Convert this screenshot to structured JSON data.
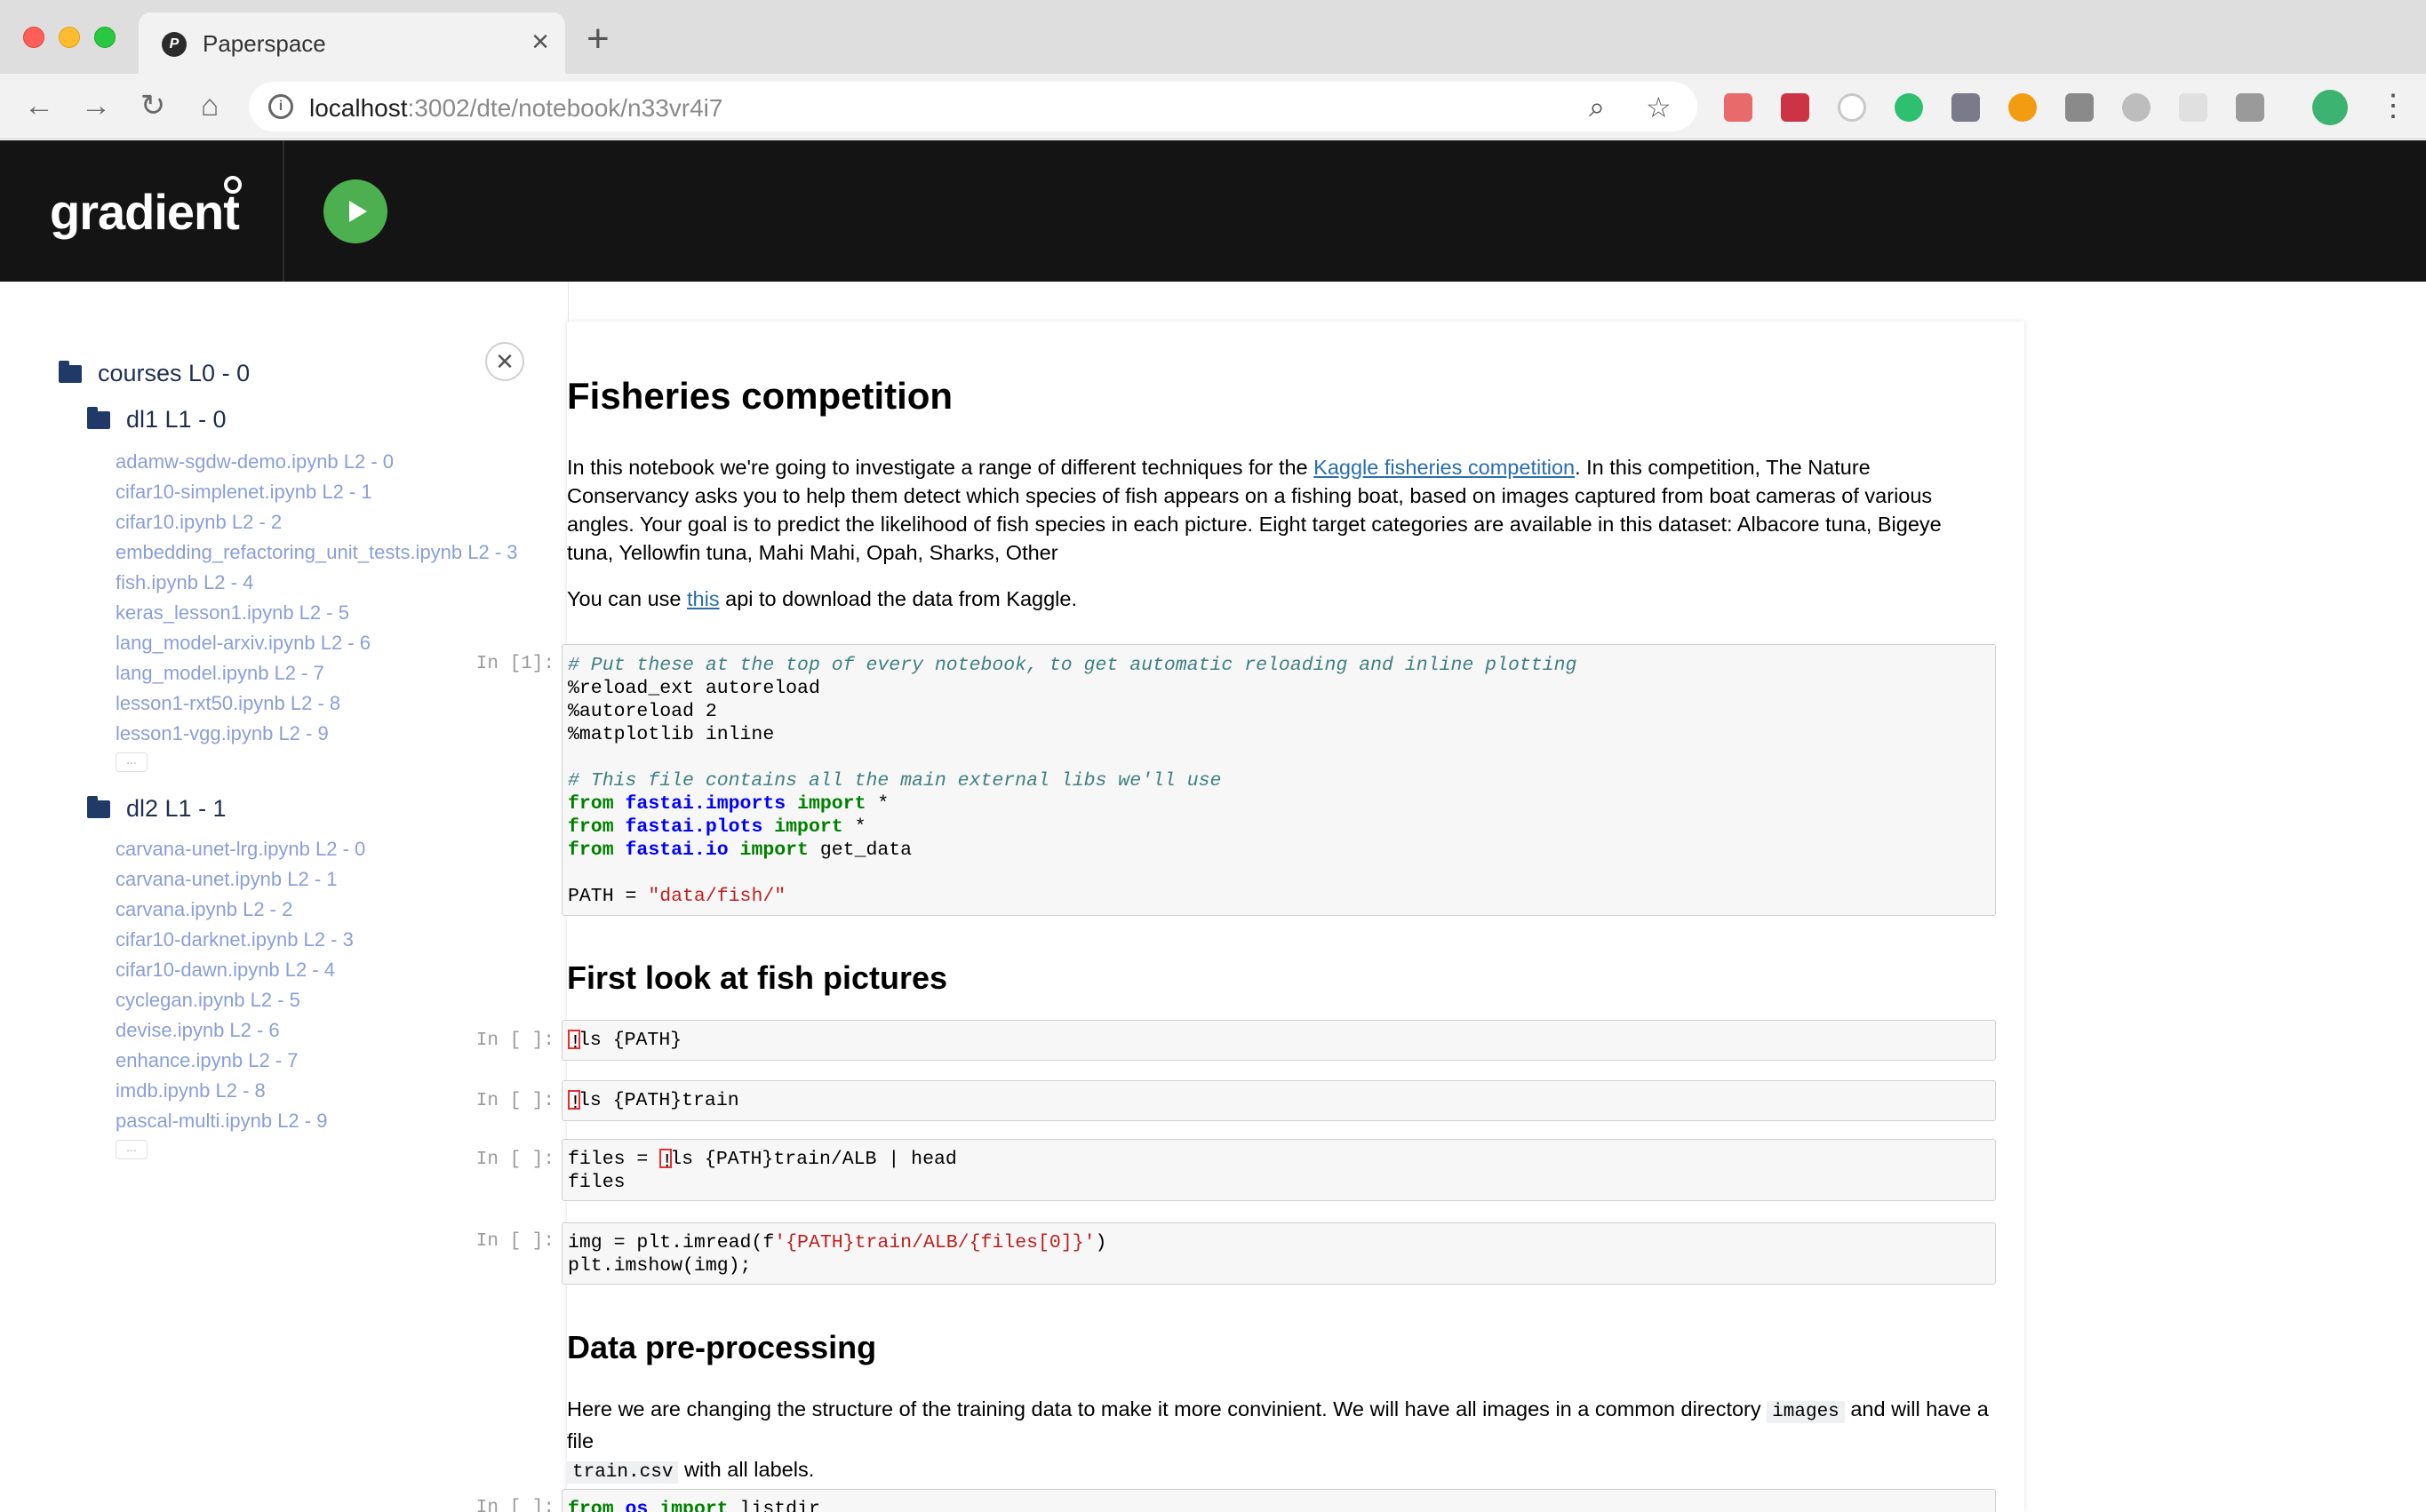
{
  "browser": {
    "tab_title": "Paperspace",
    "url_host": "localhost",
    "url_rest": ":3002/dte/notebook/n33vr4i7"
  },
  "app": {
    "logo_text": "gradient"
  },
  "sidebar": {
    "root_folder": "courses L0 - 0",
    "folders": [
      {
        "label": "dl1 L1 - 0",
        "files": [
          "adamw-sgdw-demo.ipynb L2 - 0",
          "cifar10-simplenet.ipynb L2 - 1",
          "cifar10.ipynb L2 - 2",
          "embedding_refactoring_unit_tests.ipynb L2 - 3",
          "fish.ipynb L2 - 4",
          "keras_lesson1.ipynb L2 - 5",
          "lang_model-arxiv.ipynb L2 - 6",
          "lang_model.ipynb L2 - 7",
          "lesson1-rxt50.ipynb L2 - 8",
          "lesson1-vgg.ipynb L2 - 9"
        ],
        "more": "..."
      },
      {
        "label": "dl2 L1 - 1",
        "files": [
          "carvana-unet-lrg.ipynb L2 - 0",
          "carvana-unet.ipynb L2 - 1",
          "carvana.ipynb L2 - 2",
          "cifar10-darknet.ipynb L2 - 3",
          "cifar10-dawn.ipynb L2 - 4",
          "cyclegan.ipynb L2 - 5",
          "devise.ipynb L2 - 6",
          "enhance.ipynb L2 - 7",
          "imdb.ipynb L2 - 8",
          "pascal-multi.ipynb L2 - 9"
        ],
        "more": "..."
      }
    ]
  },
  "notebook": {
    "title": "Fisheries competition",
    "intro": {
      "before_link": "In this notebook we're going to investigate a range of different techniques for the ",
      "link": "Kaggle fisheries competition",
      "after_link": ". In this competition, The Nature Conservancy asks you to help them detect which species of fish appears on a fishing boat, based on images captured from boat cameras of various angles. Your goal is to predict the likelihood of fish species in each picture. Eight target categories are available in this dataset: Albacore tuna, Bigeye tuna, Yellowfin tuna, Mahi Mahi, Opah, Sharks, Other"
    },
    "api_line": {
      "before": "You can use ",
      "link": "this",
      "after": " api to download the data from Kaggle."
    },
    "cell1": {
      "prompt": "In [1]:",
      "comment1": "# Put these at the top of every notebook, to get automatic reloading and inline plotting",
      "line2": "%reload_ext autoreload",
      "line3": "%autoreload 2",
      "line4": "%matplotlib inline",
      "comment2": "# This file contains all the main external libs we'll use",
      "kw_from": "from",
      "kw_import": "import",
      "mod1": "fastai.imports",
      "mod2": "fastai.plots",
      "mod3": "fastai.io",
      "star": " *",
      "get_data": " get_data",
      "path_lhs": "PATH = ",
      "path_str": "\"data/fish/\""
    },
    "section2": "First look at fish pictures",
    "cell2": {
      "prompt": "In [ ]:",
      "bang": "!",
      "code": "ls {PATH}"
    },
    "cell3": {
      "prompt": "In [ ]:",
      "bang": "!",
      "code": "ls {PATH}train"
    },
    "cell4": {
      "prompt": "In [ ]:",
      "pre": "files = ",
      "bang": "!",
      "code": "ls {PATH}train/ALB | head",
      "line2": "files"
    },
    "cell5": {
      "prompt": "In [ ]:",
      "pre": "img = plt.imread(f",
      "str": "'{PATH}train/ALB/{files[0]}'",
      "post": ")",
      "line2": "plt.imshow(img);"
    },
    "section3": "Data pre-processing",
    "prep": {
      "p1": "Here we are changing the structure of the training data to make it more convinient. We will have all images in a common directory ",
      "code1": "images",
      "p2": " and will have a file ",
      "code2": "train.csv",
      "p3": " with all labels."
    },
    "cell6": {
      "prompt": "In [ ]:",
      "kw_from": "from",
      "mod": "os",
      "kw_import": "import",
      "rest": " listdir"
    }
  }
}
